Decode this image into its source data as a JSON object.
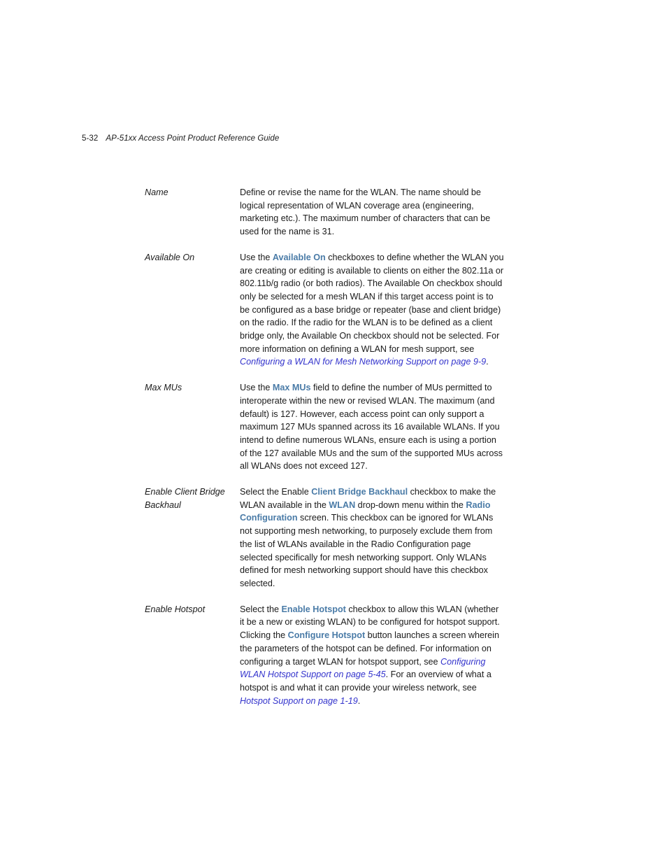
{
  "header": {
    "folio": "5-32",
    "book_title": "AP-51xx Access Point Product Reference Guide"
  },
  "colors": {
    "ui_term_blue": "#4a7ba7",
    "crossref_blue": "#3333cc",
    "body_text": "#1a1a1a",
    "page_background": "#ffffff"
  },
  "definitions": [
    {
      "term": "Name",
      "description": "Define or revise the name for the WLAN. The name should be logical representation of WLAN coverage area (engineering, marketing etc.). The maximum number of characters that can be used for the name is 31.",
      "segments": [
        {
          "type": "text",
          "text": "Define or revise the name for the WLAN. The name should be logical representation of WLAN coverage area (engineering, marketing etc.). The maximum number of characters that can be used for the name is 31."
        }
      ]
    },
    {
      "term": "Available On",
      "description": "Use the Available On checkboxes to define whether the WLAN you are creating or editing is available to clients on either the 802.11a or 802.11b/g radio (or both radios). The Available On checkbox should only be selected for a mesh WLAN if this target access point is to be configured as a base bridge or repeater (base and client bridge) on the radio. If the radio for the WLAN is to be defined as a client bridge only, the Available On checkbox should not be selected. For more information on defining a WLAN for mesh support, see Configuring a WLAN for Mesh Networking Support on page 9-9.",
      "segments": [
        {
          "type": "text",
          "text": "Use the "
        },
        {
          "type": "ui-term",
          "text": "Available On"
        },
        {
          "type": "text",
          "text": " checkboxes to define whether the WLAN you are creating or editing is available to clients on either the 802.11a or 802.11b/g radio (or both radios). The Available On checkbox should only be selected for a mesh WLAN if this target access point is to be configured as a base bridge or repeater (base and client bridge) on the radio. If the radio for the WLAN is to be defined as a client bridge only, the Available On checkbox should not be selected. For more information on defining a WLAN for mesh support, see "
        },
        {
          "type": "xref",
          "text": "Configuring a WLAN for Mesh Networking Support on page 9-9"
        },
        {
          "type": "text",
          "text": "."
        }
      ]
    },
    {
      "term": "Max MUs",
      "description": "Use the Max MUs field to define the number of MUs permitted to interoperate within the new or revised WLAN. The maximum (and default) is 127. However, each access point can only support a maximum 127 MUs spanned across its 16 available WLANs. If you intend to define numerous WLANs, ensure each is using a portion of the 127 available MUs and the sum of the supported MUs across all WLANs does not exceed 127.",
      "segments": [
        {
          "type": "text",
          "text": "Use the "
        },
        {
          "type": "ui-term",
          "text": "Max MUs"
        },
        {
          "type": "text",
          "text": " field to define the number of MUs permitted to interoperate within the new or revised WLAN. The maximum (and default) is 127. However, each access point can only support a maximum 127 MUs spanned across its 16 available WLANs. If you intend to define numerous WLANs, ensure each is using a portion of the 127 available MUs and the sum of the supported MUs across all WLANs does not exceed 127."
        }
      ]
    },
    {
      "term": "Enable Client Bridge Backhaul",
      "description": "Select the Enable Client Bridge Backhaul checkbox to make the WLAN available in the WLAN drop-down menu within the Radio Configuration screen. This checkbox can be ignored for WLANs not supporting mesh networking, to purposely exclude them from the list of WLANs available in the Radio Configuration page selected specifically for mesh networking support. Only WLANs defined for mesh networking support should have this checkbox selected.",
      "segments": [
        {
          "type": "text",
          "text": "Select the Enable "
        },
        {
          "type": "ui-term",
          "text": "Client Bridge Backhaul"
        },
        {
          "type": "text",
          "text": " checkbox to make the WLAN available in the "
        },
        {
          "type": "ui-term",
          "text": "WLAN"
        },
        {
          "type": "text",
          "text": " drop-down menu within the "
        },
        {
          "type": "ui-term",
          "text": "Radio Configuration"
        },
        {
          "type": "text",
          "text": " screen. This checkbox can be ignored for WLANs not supporting mesh networking, to purposely exclude them from the list of WLANs available in the Radio Configuration page selected specifically for mesh networking support. Only WLANs defined for mesh networking support should have this checkbox selected."
        }
      ]
    },
    {
      "term": "Enable Hotspot",
      "description": "Select the Enable Hotspot checkbox to allow this WLAN (whether it be a new or existing WLAN) to be configured for hotspot support. Clicking the Configure Hotspot button launches a screen wherein the parameters of the hotspot can be defined. For information on configuring a target WLAN for hotspot support, see Configuring WLAN Hotspot Support on page 5-45. For an overview of what a hotspot is and what it can provide your wireless network, see Hotspot Support on page 1-19.",
      "segments": [
        {
          "type": "text",
          "text": "Select the "
        },
        {
          "type": "ui-term",
          "text": "Enable Hotspot"
        },
        {
          "type": "text",
          "text": " checkbox to allow this WLAN (whether it be a new or existing WLAN) to be configured for hotspot support. Clicking the "
        },
        {
          "type": "ui-term",
          "text": "Configure Hotspot"
        },
        {
          "type": "text",
          "text": " button launches a screen wherein the parameters of the hotspot can be defined. For information on configuring a target WLAN for hotspot support, see "
        },
        {
          "type": "xref",
          "text": "Configuring WLAN Hotspot Support on page 5-45"
        },
        {
          "type": "text",
          "text": ". For an overview of what a hotspot is and what it can provide your wireless network, see "
        },
        {
          "type": "xref",
          "text": "Hotspot Support on page 1-19"
        },
        {
          "type": "text",
          "text": "."
        }
      ]
    }
  ]
}
